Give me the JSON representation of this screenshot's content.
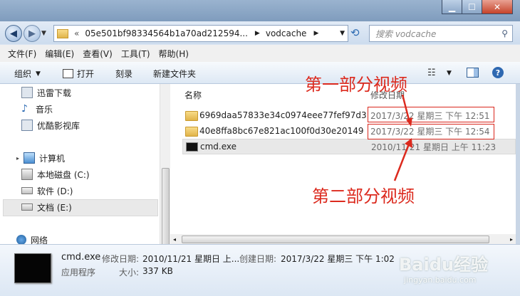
{
  "address": {
    "segments": [
      "05e501bf98334564b1a70ad212594...",
      "vodcache"
    ],
    "search_placeholder": "搜索 vodcache"
  },
  "menu": [
    "文件(F)",
    "编辑(E)",
    "查看(V)",
    "工具(T)",
    "帮助(H)"
  ],
  "toolbar": {
    "organize": "组织",
    "open": "打开",
    "burn": "刻录",
    "new_folder": "新建文件夹"
  },
  "nav": {
    "items": [
      "迅雷下载",
      "音乐",
      "优酷影视库"
    ],
    "computer": "计算机",
    "drives": [
      "本地磁盘 (C:)",
      "软件 (D:)",
      "文档 (E:)"
    ],
    "network": "网络"
  },
  "columns": {
    "name": "名称",
    "date": "修改日期"
  },
  "files": [
    {
      "name": "6969daa57833e34c0974eee77fef97d3",
      "date": "2017/3/22 星期三 下午 12:51",
      "type": "folder"
    },
    {
      "name": "40e8ffa8bc67e821ac100f0d30e20149",
      "date": "2017/3/22 星期三 下午 12:54",
      "type": "folder"
    },
    {
      "name": "cmd.exe",
      "date": "2010/11/21 星期日 上午 11:23",
      "type": "exe"
    }
  ],
  "details": {
    "name": "cmd.exe",
    "mod_label": "修改日期:",
    "mod_value": "2010/11/21 星期日 上...",
    "create_label": "创建日期:",
    "create_value": "2017/3/22 星期三 下午 1:02",
    "type": "应用程序",
    "size_label": "大小:",
    "size_value": "337 KB"
  },
  "annotations": {
    "first": "第一部分视频",
    "second": "第二部分视频"
  },
  "watermark": {
    "brand": "Baidu经验",
    "url": "jingyan.baidu.com"
  },
  "colors": {
    "annotation": "#dc2a1e",
    "selected_row": "#e8e8e8"
  }
}
